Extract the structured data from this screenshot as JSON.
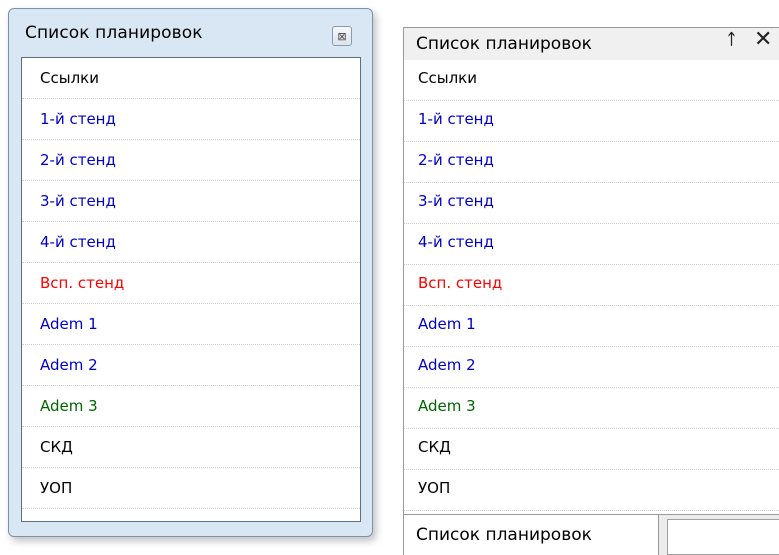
{
  "floating_window": {
    "title": "Список планировок",
    "close_glyph": "⊠",
    "items": [
      {
        "label": "Ссылки",
        "color": "#000000"
      },
      {
        "label": "1-й стенд",
        "color": "#0000cc"
      },
      {
        "label": "2-й стенд",
        "color": "#0000cc"
      },
      {
        "label": "3-й стенд",
        "color": "#0000cc"
      },
      {
        "label": "4-й стенд",
        "color": "#0000cc"
      },
      {
        "label": "Всп. стенд",
        "color": "#ff0000"
      },
      {
        "label": "Adem 1",
        "color": "#0000cc"
      },
      {
        "label": "Adem 2",
        "color": "#0000cc"
      },
      {
        "label": "Adem 3",
        "color": "#006600"
      },
      {
        "label": "СКД",
        "color": "#000000"
      },
      {
        "label": "УОП",
        "color": "#000000"
      }
    ]
  },
  "docked_panel": {
    "title": "Список планировок",
    "pin_glyph": "ᚁ",
    "close_glyph": "✕",
    "items": [
      {
        "label": "Ссылки",
        "color": "#000000"
      },
      {
        "label": "1-й стенд",
        "color": "#0000cc"
      },
      {
        "label": "2-й стенд",
        "color": "#0000cc"
      },
      {
        "label": "3-й стенд",
        "color": "#0000cc"
      },
      {
        "label": "4-й стенд",
        "color": "#0000cc"
      },
      {
        "label": "Всп. стенд",
        "color": "#ff0000"
      },
      {
        "label": "Adem 1",
        "color": "#0000cc"
      },
      {
        "label": "Adem 2",
        "color": "#0000cc"
      },
      {
        "label": "Adem 3",
        "color": "#006600"
      },
      {
        "label": "СКД",
        "color": "#000000"
      },
      {
        "label": "УОП",
        "color": "#000000"
      }
    ],
    "tab_label": "Список планировок"
  }
}
